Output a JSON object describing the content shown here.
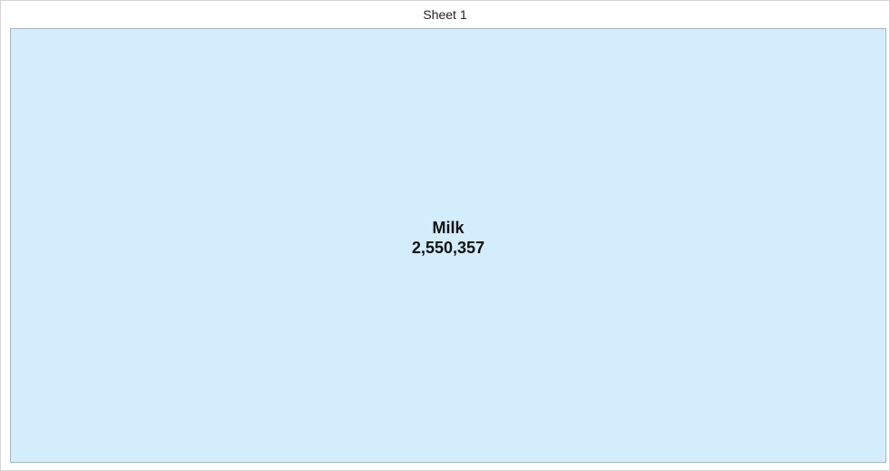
{
  "sheet": {
    "title": "Sheet 1"
  },
  "treemap": {
    "tiles": [
      {
        "label": "Milk",
        "value_text": "2,550,357",
        "value": 2550357,
        "color": "#d3edfd"
      }
    ]
  }
}
